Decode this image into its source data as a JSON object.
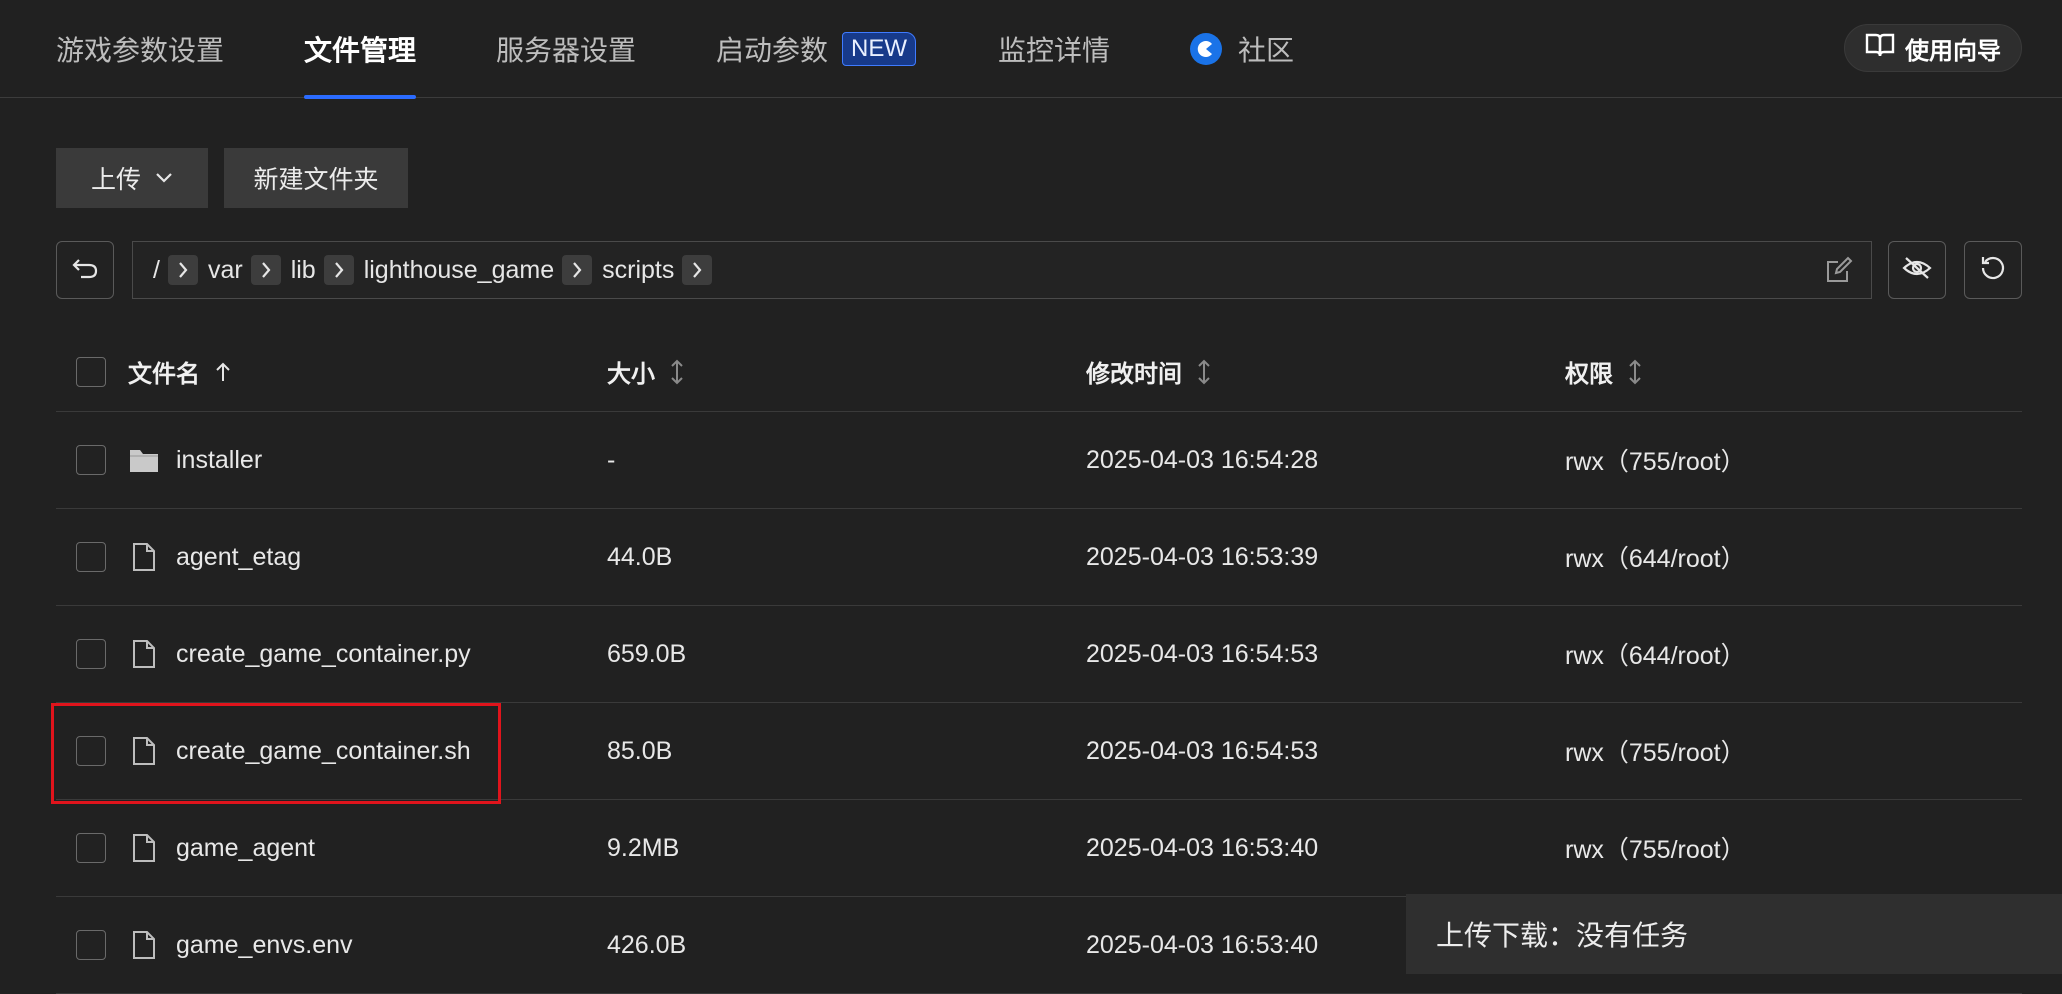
{
  "tabs": [
    {
      "label": "游戏参数设置"
    },
    {
      "label": "文件管理"
    },
    {
      "label": "服务器设置"
    },
    {
      "label": "启动参数",
      "badge": "NEW"
    },
    {
      "label": "监控详情"
    },
    {
      "label": "社区"
    }
  ],
  "guide_button": "使用向导",
  "toolbar": {
    "upload": "上传",
    "new_folder": "新建文件夹"
  },
  "path": {
    "root": "/",
    "segments": [
      "var",
      "lib",
      "lighthouse_game",
      "scripts"
    ]
  },
  "table": {
    "headers": {
      "name": "文件名",
      "size": "大小",
      "mtime": "修改时间",
      "perm": "权限"
    },
    "rows": [
      {
        "name": "installer",
        "type": "folder-icon",
        "size": "-",
        "mtime": "2025-04-03 16:54:28",
        "perm": "rwx（755/root）"
      },
      {
        "name": "agent_etag",
        "type": "file-icon",
        "size": "44.0B",
        "mtime": "2025-04-03 16:53:39",
        "perm": "rwx（644/root）"
      },
      {
        "name": "create_game_container.py",
        "type": "file-icon",
        "size": "659.0B",
        "mtime": "2025-04-03 16:54:53",
        "perm": "rwx（644/root）"
      },
      {
        "name": "create_game_container.sh",
        "type": "file-icon",
        "size": "85.0B",
        "mtime": "2025-04-03 16:54:53",
        "perm": "rwx（755/root）"
      },
      {
        "name": "game_agent",
        "type": "file-icon",
        "size": "9.2MB",
        "mtime": "2025-04-03 16:53:40",
        "perm": "rwx（755/root）"
      },
      {
        "name": "game_envs.env",
        "type": "file-icon",
        "size": "426.0B",
        "mtime": "2025-04-03 16:53:40",
        "perm": ""
      }
    ]
  },
  "upload_panel": {
    "text": "上传下载：没有任务"
  },
  "colors": {
    "accent": "#2b6bff",
    "highlight": "#e0141c",
    "background": "#212121"
  }
}
